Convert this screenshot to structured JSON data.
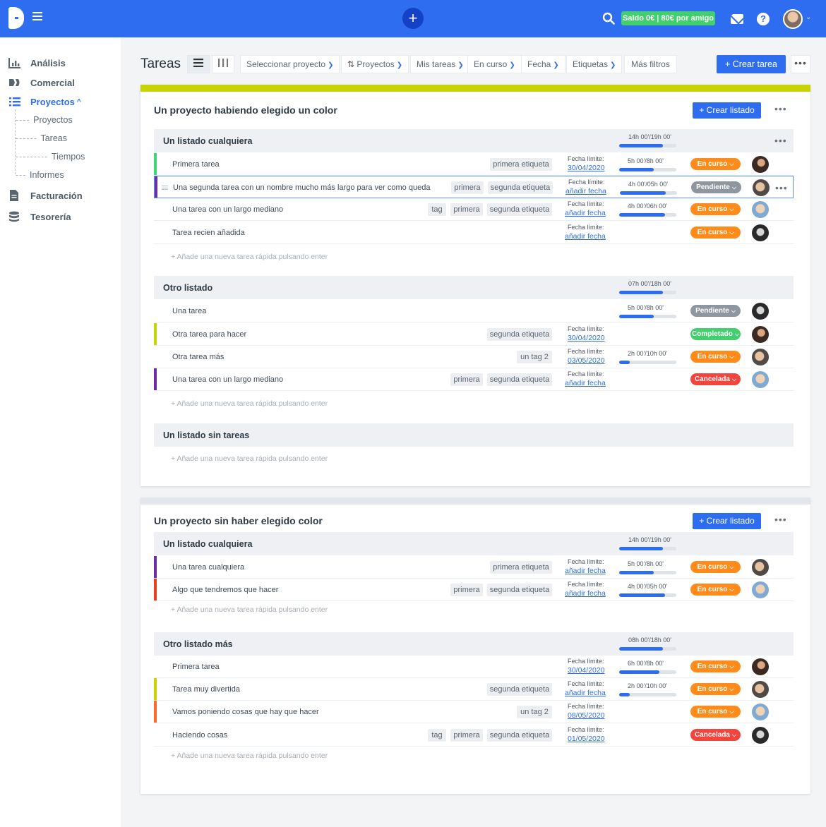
{
  "topbar": {
    "saldo": "Saldo 0€ | 80€ por amigo",
    "plus": "+",
    "help": "?",
    "accent": "#2f6df0"
  },
  "sidebar": {
    "items": [
      {
        "label": "Análisis",
        "icon": "chart-icon"
      },
      {
        "label": "Comercial",
        "icon": "tickets-icon"
      },
      {
        "label": "Proyectos",
        "icon": "list-icon"
      },
      {
        "label": "Facturación",
        "icon": "document-icon"
      },
      {
        "label": "Tesorería",
        "icon": "database-icon"
      }
    ],
    "proyectos_caret": "^",
    "subitems": [
      "Proyectos",
      "Tareas",
      "Tiempos",
      "Informes"
    ]
  },
  "toolbar": {
    "title": "Tareas",
    "filters": [
      "Seleccionar proyecto",
      "Proyectos",
      "Mis tareas",
      "En curso",
      "Fecha",
      "Etiquetas",
      "Más filtros"
    ],
    "create": "+ Crear tarea",
    "more": "•••"
  },
  "common": {
    "due_label": "Fecha límite:",
    "quick_add": "+  Añade una nueva tarea rápida pulsando enter",
    "create_list": "+ Crear listado",
    "more": "•••"
  },
  "projects": [
    {
      "title": "Un proyecto habiendo elegido un color",
      "color": "#c8d400",
      "lists": [
        {
          "title": "Un listado cualquiera",
          "hours": "14h 00'/19h 00'",
          "progress": 0.76,
          "tasks": [
            {
              "name": "Primera tarea",
              "stripe": "#3dd77a",
              "tags": [
                "primera etiqueta"
              ],
              "due": "30/04/2020",
              "hours": "5h 00'/8h 00'",
              "progress": 0.6,
              "status": "En curso",
              "status_color": "#ff8c1a"
            },
            {
              "name": "Una segunda tarea con un nombre mucho más largo para ver como queda",
              "stripe": "#6a2fa5",
              "tags": [
                "primera",
                "segunda etiqueta"
              ],
              "due": "añadir fecha",
              "hours": "4h 00'/05h 00'",
              "progress": 0.8,
              "status": "Pendiente",
              "status_color": "#8e96a0",
              "selected": true
            },
            {
              "name": "Una tarea con un largo mediano",
              "stripe": "",
              "tags": [
                "tag",
                "primera",
                "segunda etiqueta"
              ],
              "due": "añadir fecha",
              "hours": "4h 00'/06h 00'",
              "progress": 0.8,
              "status": "En curso",
              "status_color": "#ff8c1a"
            },
            {
              "name": "Tarea recien añadida",
              "stripe": "",
              "tags": [],
              "due": "añadir fecha",
              "hours": "",
              "progress": null,
              "status": "En curso",
              "status_color": "#ff8c1a"
            }
          ]
        },
        {
          "title": "Otro listado",
          "hours": "07h 00'/18h 00'",
          "progress": 0.76,
          "tasks": [
            {
              "name": "Una  tarea",
              "stripe": "",
              "tags": [],
              "due": "",
              "hours": "5h 00'/8h 00'",
              "progress": 0.6,
              "status": "Pendiente",
              "status_color": "#8e96a0"
            },
            {
              "name": "Otra tarea para hacer",
              "stripe": "#c8d400",
              "tags": [
                "segunda etiqueta"
              ],
              "due": "30/04/2020",
              "hours": "",
              "progress": null,
              "status": "Completado",
              "status_color": "#42d06e"
            },
            {
              "name": "Otra tarea más",
              "stripe": "",
              "tags": [
                "un tag 2"
              ],
              "due": "03/05/2020",
              "hours": "2h 00'/10h 00'",
              "progress": 0.18,
              "status": "En curso",
              "status_color": "#ff8c1a"
            },
            {
              "name": "Una tarea con un largo mediano",
              "stripe": "#6a2fa5",
              "tags": [
                "primera",
                "segunda etiqueta"
              ],
              "due": "añadir fecha",
              "hours": "",
              "progress": null,
              "status": "Cancelada",
              "status_color": "#f2453d"
            }
          ]
        },
        {
          "title": "Un listado sin tareas",
          "hours": "",
          "progress": null,
          "tasks": []
        }
      ]
    },
    {
      "title": "Un proyecto sin haber elegido color",
      "color": "#e3e6ea",
      "lists": [
        {
          "title": "Un listado cualquiera",
          "hours": "14h 00'/19h 00'",
          "progress": 0.76,
          "tasks": [
            {
              "name": "Una tarea cualquiera",
              "stripe": "#6a2fa5",
              "tags": [
                "primera etiqueta"
              ],
              "due": "añadir fecha",
              "hours": "5h 00'/8h 00'",
              "progress": 0.6,
              "status": "En curso",
              "status_color": "#ff8c1a"
            },
            {
              "name": "Algo que tendremos que hacer",
              "stripe": "#e8401c",
              "tags": [
                "primera",
                "segunda etiqueta"
              ],
              "due": "añadir fecha",
              "hours": "4h 00'/05h 00'",
              "progress": 0.8,
              "status": "En curso",
              "status_color": "#ff8c1a"
            }
          ]
        },
        {
          "title": "Otro listado más",
          "hours": "08h 00'/18h 00'",
          "progress": 0.76,
          "tasks": [
            {
              "name": "Primera tarea",
              "stripe": "",
              "tags": [],
              "due": "30/04/2020",
              "hours": "6h 00'/8h 00'",
              "progress": 0.7,
              "status": "En curso",
              "status_color": "#ff8c1a"
            },
            {
              "name": "Tarea muy divertida",
              "stripe": "#c8d400",
              "tags": [
                "segunda etiqueta"
              ],
              "due": "añadir fecha",
              "hours": "2h 00'/10h 00'",
              "progress": 0.18,
              "status": "En curso",
              "status_color": "#ff8c1a"
            },
            {
              "name": "Vamos poniendo cosas que hay que hacer",
              "stripe": "#ff6a2a",
              "tags": [
                "un tag 2"
              ],
              "due": "08/05/2020",
              "hours": "",
              "progress": null,
              "status": "En curso",
              "status_color": "#ff8c1a"
            },
            {
              "name": "Haciendo cosas",
              "stripe": "",
              "tags": [
                "tag",
                "primera",
                "segunda etiqueta"
              ],
              "due": "01/05/2020",
              "hours": "",
              "progress": null,
              "status": "Cancelada",
              "status_color": "#f2453d"
            }
          ]
        }
      ]
    }
  ]
}
